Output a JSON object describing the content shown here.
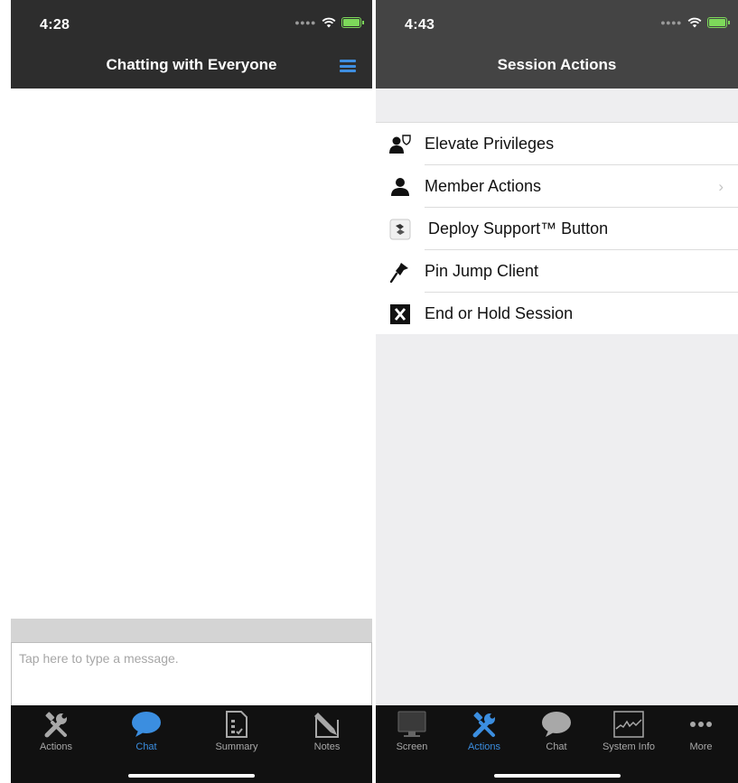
{
  "left_phone": {
    "status_time": "4:28",
    "nav_title": "Chatting with Everyone",
    "message_placeholder": "Tap here to type a message.",
    "tabs": [
      {
        "label": "Actions",
        "icon": "tools-icon"
      },
      {
        "label": "Chat",
        "icon": "chat-bubble-icon"
      },
      {
        "label": "Summary",
        "icon": "summary-doc-icon"
      },
      {
        "label": "Notes",
        "icon": "notes-icon"
      }
    ],
    "active_tab": "Chat"
  },
  "right_phone": {
    "status_time": "4:43",
    "nav_title": "Session Actions",
    "actions": [
      {
        "label": "Elevate Privileges",
        "icon": "elevate-user-icon"
      },
      {
        "label": "Member Actions",
        "icon": "member-icon",
        "has_chevron": true
      },
      {
        "label": "Deploy Support™ Button",
        "icon": "support-button-icon"
      },
      {
        "label": "Pin Jump Client",
        "icon": "pin-icon"
      },
      {
        "label": "End or Hold Session",
        "icon": "x-box-icon"
      }
    ],
    "tabs": [
      {
        "label": "Screen",
        "icon": "monitor-icon"
      },
      {
        "label": "Actions",
        "icon": "tools-icon"
      },
      {
        "label": "Chat",
        "icon": "chat-bubble-icon"
      },
      {
        "label": "System Info",
        "icon": "system-info-icon"
      },
      {
        "label": "More",
        "icon": "more-dots-icon"
      }
    ],
    "active_tab": "Actions"
  },
  "colors": {
    "accent": "#3b8ee0",
    "battery": "#7dd95a",
    "nav_bg_left": "#2d2d2d",
    "nav_bg_right": "#444444",
    "tabbar_bg": "#111111"
  }
}
